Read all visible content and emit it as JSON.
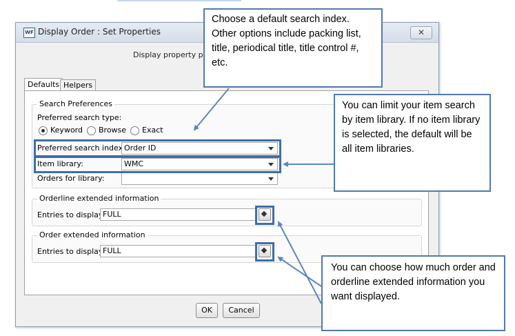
{
  "window": {
    "title": "Display Order : Set Properties",
    "app_icon": "WF",
    "close_label": "✕"
  },
  "subtitle": "Display property pag",
  "tabs": [
    {
      "label": "Defaults"
    },
    {
      "label": "Helpers"
    }
  ],
  "search_preferences": {
    "legend": "Search Preferences",
    "type_label": "Preferred search type:",
    "radios": [
      {
        "label": "Keyword",
        "selected": true
      },
      {
        "label": "Browse",
        "selected": false
      },
      {
        "label": "Exact",
        "selected": false
      }
    ],
    "index_label": "Preferred search index:",
    "index_value": "Order ID",
    "library_label": "Item library:",
    "library_value": "WMC",
    "orders_label": "Orders for library:",
    "orders_value": ""
  },
  "orderline_ext": {
    "legend": "Orderline extended information",
    "entries_label": "Entries to display:",
    "entries_value": "FULL"
  },
  "order_ext": {
    "legend": "Order extended information",
    "entries_label": "Entries to display:",
    "entries_value": "FULL"
  },
  "buttons": {
    "ok": "OK",
    "cancel": "Cancel"
  },
  "callouts": {
    "index": "Choose a default search index. Other options include packing list, title, periodical title, title control #, etc.",
    "library": "You can limit your item search by item library. If no item library is selected, the default will be all item libraries.",
    "extended": "You can choose how much order and orderline extended information you want displayed."
  },
  "colors": {
    "highlight": "#3e6ea8",
    "callout_border": "#4f79b0",
    "arrow": "#5b86bd"
  }
}
